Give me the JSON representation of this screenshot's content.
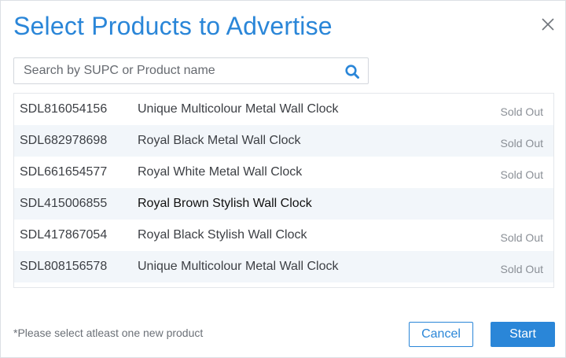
{
  "dialog": {
    "title": "Select Products to Advertise",
    "close_icon": "close-icon"
  },
  "search": {
    "placeholder": "Search by SUPC or Product name",
    "value": "",
    "icon": "search-icon"
  },
  "products": [
    {
      "sku": "SDL816054156",
      "name": "Unique Multicolour Metal Wall Clock",
      "status": "Sold Out"
    },
    {
      "sku": "SDL682978698",
      "name": "Royal Black Metal Wall Clock",
      "status": "Sold Out"
    },
    {
      "sku": "SDL661654577",
      "name": "Royal White Metal Wall Clock",
      "status": "Sold Out"
    },
    {
      "sku": "SDL415006855",
      "name": "Royal Brown Stylish Wall Clock",
      "status": ""
    },
    {
      "sku": "SDL417867054",
      "name": "Royal Black Stylish Wall Clock",
      "status": "Sold Out"
    },
    {
      "sku": "SDL808156578",
      "name": "Unique Multicolour Metal Wall Clock",
      "status": "Sold Out"
    }
  ],
  "footer": {
    "note": "*Please select atleast one new product",
    "cancel_label": "Cancel",
    "start_label": "Start"
  },
  "colors": {
    "accent": "#2a86d8",
    "row_alt": "#f2f6fa",
    "muted_text": "#8a8f96"
  }
}
